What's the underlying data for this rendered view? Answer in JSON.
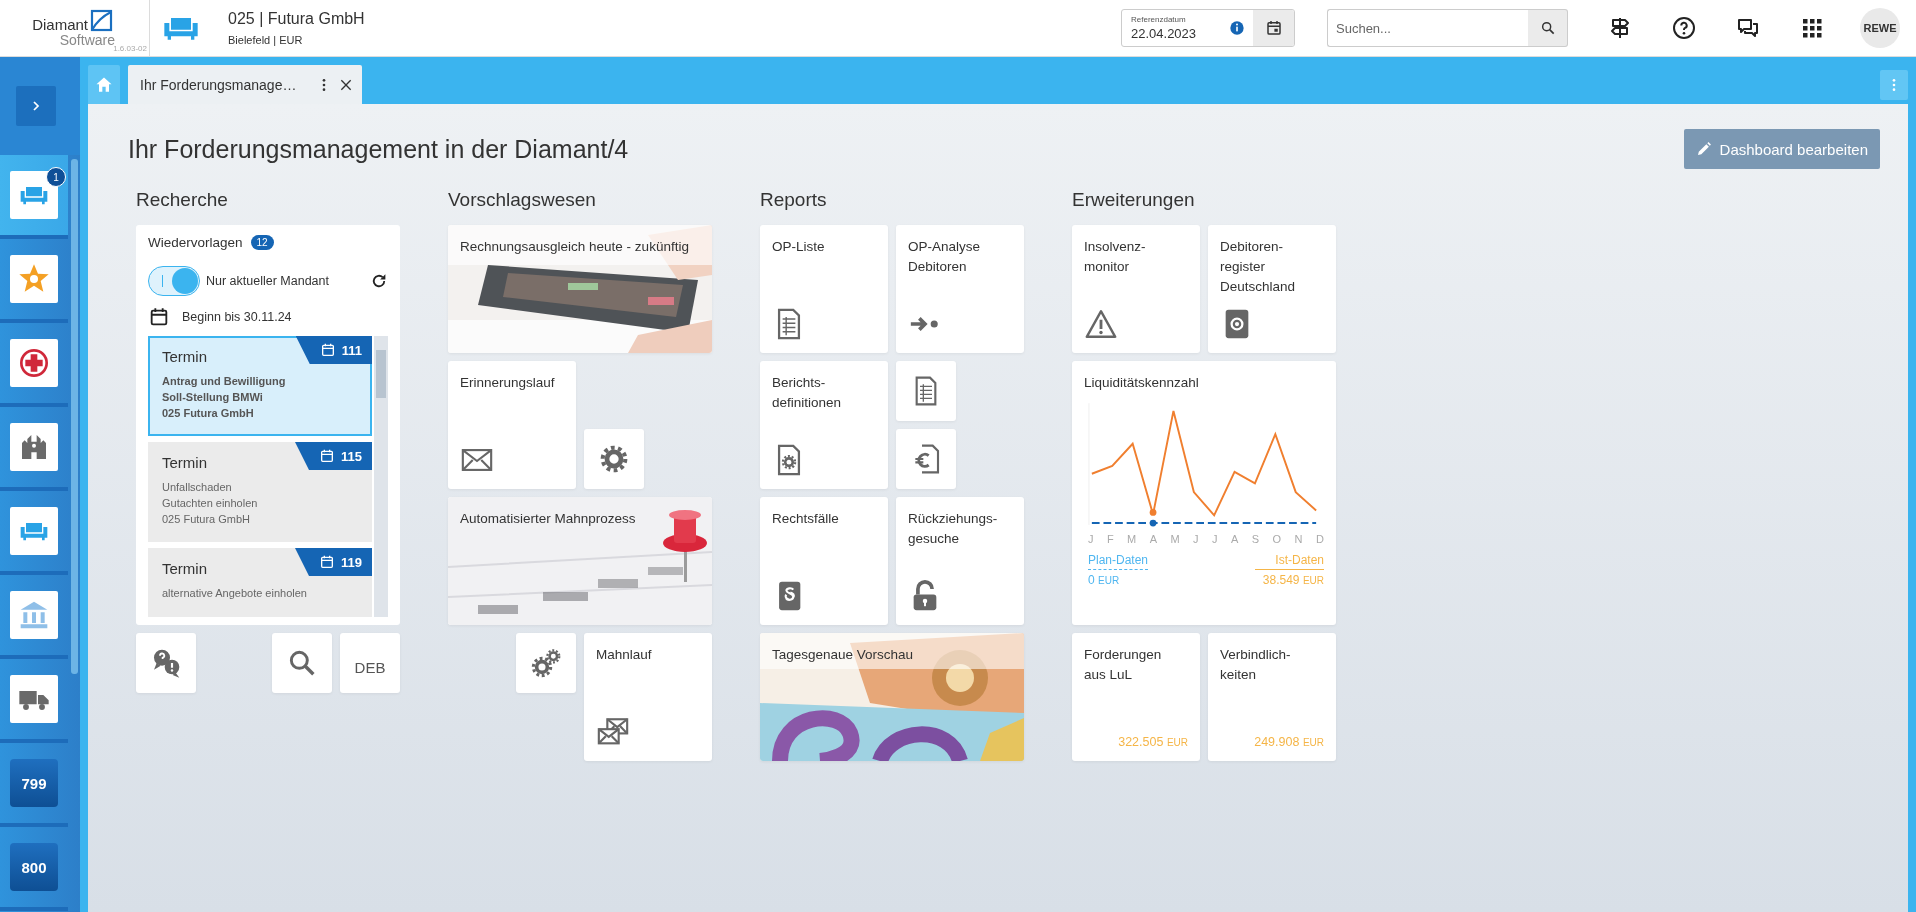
{
  "header": {
    "logo": {
      "name": "Diamant",
      "sub": "Software",
      "version": "1.6.03-02"
    },
    "company": {
      "title": "025 | Futura GmbH",
      "subtitle": "Bielefeld | EUR"
    },
    "reference_date": {
      "label": "Referenzdatum",
      "value": "22.04.2023"
    },
    "search": {
      "placeholder": "Suchen..."
    },
    "user": "REWE"
  },
  "sidebar": {
    "items": [
      {
        "kind": "icon",
        "selected": true,
        "badge": "1"
      },
      {
        "kind": "icon",
        "selected": false
      },
      {
        "kind": "icon",
        "selected": false
      },
      {
        "kind": "icon",
        "selected": false
      },
      {
        "kind": "icon",
        "selected": false
      },
      {
        "kind": "icon",
        "selected": false
      },
      {
        "kind": "icon",
        "selected": false
      },
      {
        "kind": "number",
        "label": "799",
        "selected": false
      },
      {
        "kind": "number",
        "label": "800",
        "selected": false
      }
    ]
  },
  "tabs": [
    {
      "label": "Ihr Forderungsmanage…",
      "selected": true
    }
  ],
  "page": {
    "title": "Ihr Forderungsmanagement in der Diamant/4",
    "edit_button": "Dashboard bearbeiten"
  },
  "sections": [
    {
      "title": "Recherche",
      "tiles": [
        {
          "kind": "followups",
          "title": "Wiedervorlagen",
          "count": "12",
          "toggle": {
            "label": "Nur aktueller Mandant",
            "on": true
          },
          "period": "Beginn bis 30.11.24",
          "items": [
            {
              "title": "Termin",
              "number": "111",
              "lines": [
                "Antrag und Bewilligung",
                "Soll-Stellung BMWi",
                "025 Futura GmbH"
              ],
              "selected": true
            },
            {
              "title": "Termin",
              "number": "115",
              "lines": [
                "Unfallschaden",
                "Gutachten einholen",
                "025 Futura GmbH"
              ],
              "selected": false
            },
            {
              "title": "Termin",
              "number": "119",
              "lines": [
                "alternative Angebote einholen"
              ],
              "selected": false
            }
          ]
        },
        {
          "kind": "icon"
        },
        {
          "kind": "icon"
        },
        {
          "kind": "text",
          "label": "DEB"
        }
      ]
    },
    {
      "title": "Vorschlagswesen",
      "tiles": [
        {
          "label": "Rechnungsausgleich heute - zukünftig"
        },
        {
          "kind": "tile",
          "label": "Erinnerungslauf"
        },
        {
          "kind": "icon"
        },
        {
          "label": "Automatisierter Mahnprozess"
        },
        {
          "kind": "icon"
        },
        {
          "kind": "tile",
          "label": "Mahnlauf"
        }
      ]
    },
    {
      "title": "Reports",
      "tiles": [
        {
          "kind": "tile",
          "label": "OP-Liste"
        },
        {
          "kind": "tile",
          "label": "OP-Analyse\nDebitoren"
        },
        {
          "kind": "tile",
          "label": "Berichts-\ndefinitionen"
        },
        {
          "kind": "icon"
        },
        {
          "kind": "icon"
        },
        {
          "kind": "tile",
          "label": "Rechtsfälle"
        },
        {
          "kind": "tile",
          "label": "Rückziehungs-\ngesuche"
        },
        {
          "label": "Tagesgenaue Vorschau"
        }
      ]
    },
    {
      "title": "Erweiterungen",
      "tiles": [
        {
          "kind": "tile",
          "label": "Insolvenz-\nmonitor"
        },
        {
          "kind": "tile",
          "label": "Debitoren-\nregister\nDeutschland"
        },
        {
          "kind": "chart",
          "title": "Liquiditätskennzahl",
          "months": [
            "J",
            "F",
            "M",
            "A",
            "M",
            "J",
            "J",
            "A",
            "S",
            "O",
            "N",
            "D"
          ],
          "plan": {
            "label": "Plan-Daten",
            "value": "0",
            "unit": "EUR"
          },
          "actual": {
            "label": "Ist-Daten",
            "value": "38.549",
            "unit": "EUR"
          }
        },
        {
          "kind": "amount",
          "label": "Forderungen\naus LuL",
          "value": "322.505",
          "unit": "EUR"
        },
        {
          "kind": "amount",
          "label": "Verbindlich-\nkeiten",
          "value": "249.908",
          "unit": "EUR"
        }
      ]
    }
  ]
}
